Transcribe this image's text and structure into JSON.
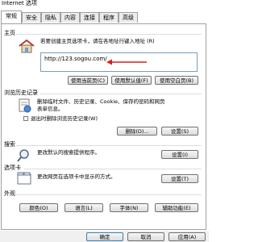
{
  "window": {
    "title": "Internet 选项"
  },
  "tabs": [
    "常规",
    "安全",
    "隐私",
    "内容",
    "连接",
    "程序",
    "高级"
  ],
  "homepage": {
    "section_label": "主页",
    "description": "若要创建主页选项卡，请在各地址行键入地址 (R)",
    "url": "http://123.sogou.com/",
    "buttons": {
      "use_current": "使用当前页(C)",
      "use_default": "使用默认值(F)",
      "use_blank": "使用空白页(B)"
    }
  },
  "history": {
    "section_label": "浏览历史记录",
    "description_line1": "删除临时文件、历史记录、Cookie、保存的密码和网页",
    "description_line2": "表单信息。",
    "checkbox_label": "退出时删除浏览历史记录(W)",
    "delete_button": "删除(D)...",
    "settings_button": "设置(S)"
  },
  "search": {
    "section_label": "搜索",
    "description": "更改默认的搜索提供程序。",
    "settings_button": "设置(I)"
  },
  "tabs_section": {
    "section_label": "选项卡",
    "description": "更改网页在选项卡中显示的方式。",
    "settings_button": "设置(T)"
  },
  "appearance": {
    "section_label": "外观",
    "colors": "颜色(O)",
    "languages": "语言(L)",
    "fonts": "字体(N)",
    "accessibility": "辅助功能(E)"
  },
  "footer": {
    "ok": "确定",
    "cancel": "取消",
    "apply": "应用(A)"
  }
}
